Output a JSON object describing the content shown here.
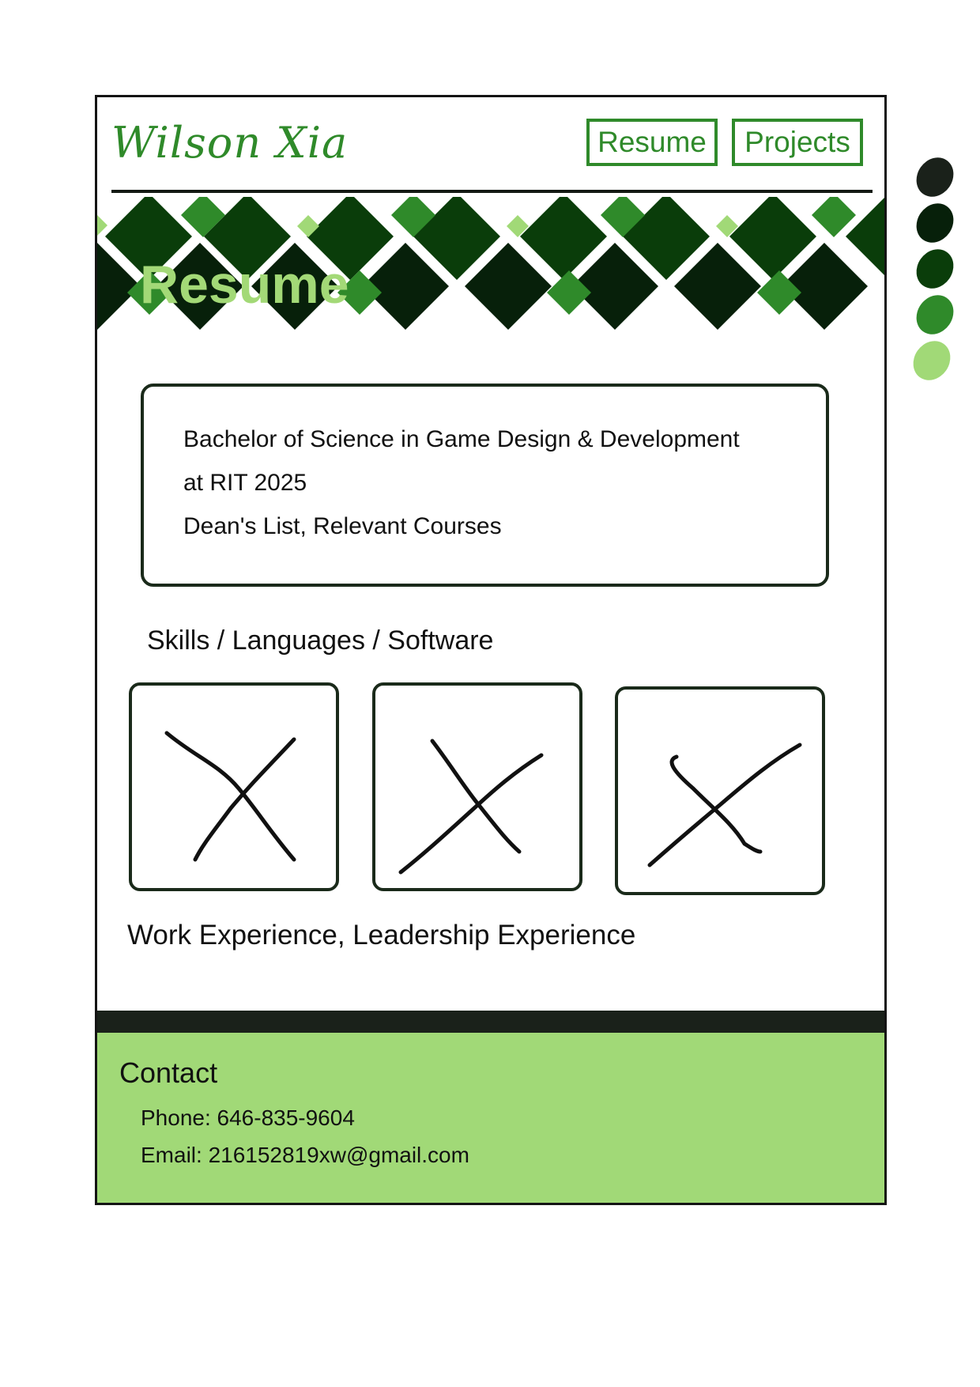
{
  "header": {
    "brand": "Wilson Xia",
    "nav": {
      "resume": "Resume",
      "projects": "Projects"
    }
  },
  "banner": {
    "title": "Resume"
  },
  "education": {
    "line1": "Bachelor of Science in Game Design & Development",
    "line2": "at RIT 2025",
    "line3": "Dean's List, Relevant Courses"
  },
  "skills": {
    "title": "Skills / Languages / Software",
    "tiles": [
      "image-placeholder",
      "image-placeholder",
      "image-placeholder"
    ]
  },
  "work": {
    "title": "Work Experience, Leadership Experience"
  },
  "contact": {
    "title": "Contact",
    "phone": "Phone: 646-835-9604",
    "email": "Email: 216152819xw@gmail.com"
  },
  "palette": {
    "colors": [
      "#1a211a",
      "#07200a",
      "#0a3d0a",
      "#2f8a2a",
      "#a1d977"
    ]
  }
}
